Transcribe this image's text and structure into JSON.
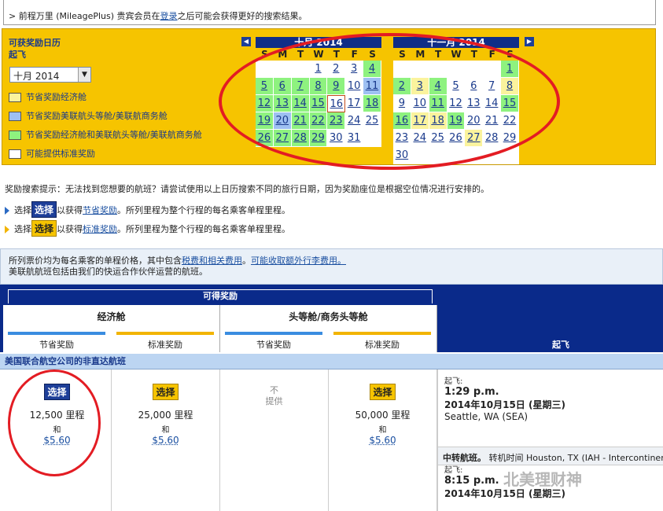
{
  "top_note": {
    "prefix": "> 前程万里 (MileagePlus) 贵宾会员在",
    "link": "登录",
    "suffix": "之后可能会获得更好的搜索结果。"
  },
  "calendar": {
    "title_line1": "可获奖励日历",
    "title_line2": "起飞",
    "selected_month": "十月 2014",
    "legend": [
      {
        "label": "节省奖励经济舱",
        "color": "#fbf39d"
      },
      {
        "label": "节省奖励美联航头等舱/美联航商务舱",
        "color": "#9ec0f2"
      },
      {
        "label": "节省奖励经济舱和美联航头等舱/美联航商务舱",
        "color": "#8ef27f"
      },
      {
        "label": "可能提供标准奖励",
        "color": "#ffffff"
      }
    ],
    "weekdays": [
      "S",
      "M",
      "T",
      "W",
      "T",
      "F",
      "S"
    ],
    "months": [
      {
        "name": "十月 2014",
        "offset": 3,
        "days": [
          "w",
          "w",
          "w",
          "g",
          "g",
          "g",
          "g",
          "g",
          "g",
          "w",
          "b",
          "g",
          "g",
          "g",
          "g",
          "today",
          "w",
          "g",
          "g",
          "b",
          "g",
          "g",
          "g",
          "w",
          "w",
          "g",
          "g",
          "g",
          "g",
          "w",
          "w"
        ]
      },
      {
        "name": "十一月 2014",
        "offset": 6,
        "days": [
          "g",
          "g",
          "y",
          "g",
          "w",
          "w",
          "w",
          "y",
          "w",
          "w",
          "g",
          "w",
          "w",
          "w",
          "g",
          "g",
          "y",
          "y",
          "g",
          "w",
          "w",
          "w",
          "w",
          "w",
          "w",
          "w",
          "y",
          "w",
          "w",
          "w"
        ]
      }
    ]
  },
  "tips": {
    "line1": "奖励搜索提示：无法找到您想要的航班？请尝试使用以上日历搜索不同的旅行日期，因为奖励座位是根据空位情况进行安排的。",
    "line2_pre": "选择",
    "line2_btn": "选择",
    "line2_mid": "以获得",
    "line2_link": "节省奖励",
    "line2_post": "。所列里程为整个行程的每名乘客单程里程。",
    "line3_btn": "选择",
    "line3_mid": "以获得",
    "line3_link": "标准奖励",
    "line3_post": "。所列里程为整个行程的每名乘客单程里程。"
  },
  "price_note": {
    "pre": "所列票价均为每名乘客的单程价格，其中包含",
    "link1": "税费和相关费用",
    "mid": "。",
    "link2": "可能收取额外行李费用。",
    "line2": "美联航航班包括由我们的快运合作伙伴运营的航班。"
  },
  "table": {
    "available": "可得奖励",
    "economy": "经济舱",
    "first": "头等舱/商务头等舱",
    "saver": "节省奖励",
    "standard": "标准奖励",
    "depart": "起飞",
    "route": "美国联合航空公司的非直达航班",
    "cells": [
      {
        "btn": "选择",
        "style": "blue",
        "miles": "12,500 里程",
        "and": "和",
        "fee": "$5.60"
      },
      {
        "btn": "选择",
        "style": "yellow",
        "miles": "25,000 里程",
        "and": "和",
        "fee": "$5.60"
      },
      {
        "na1": "不",
        "na2": "提供"
      },
      {
        "btn": "选择",
        "style": "yellow",
        "miles": "50,000 里程",
        "and": "和",
        "fee": "$5.60"
      }
    ],
    "flight": {
      "dep_label": "起飞:",
      "dep_time": "1:29 p.m.",
      "dep_date": "2014年10月15日 (星期三)",
      "dep_city": "Seattle, WA (SEA)",
      "conn_label": "中转航班。",
      "conn_text": "转机时间 Houston, TX (IAH - Intercontinental)",
      "dep2_label": "起飞:",
      "dep2_time": "8:15 p.m.",
      "dep2_date": "2014年10月15日 (星期三)"
    }
  },
  "watermark": "北美理财神"
}
